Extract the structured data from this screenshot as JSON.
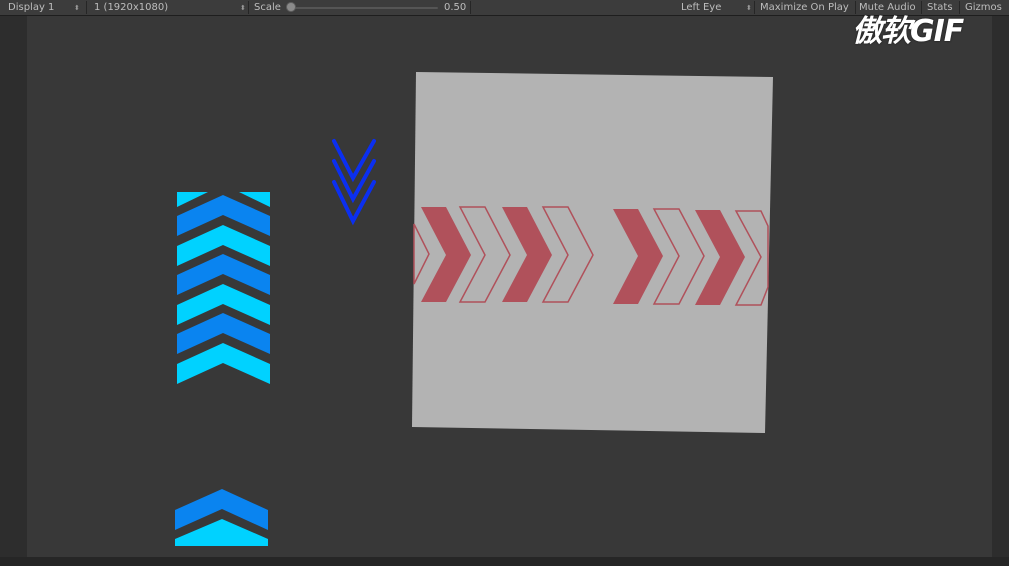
{
  "toolbar": {
    "display_label": "Display 1",
    "resolution_label": "1 (1920x1080)",
    "scale_label": "Scale",
    "scale_value": "0.50",
    "scale_fraction": 0.02,
    "eye_label": "Left Eye",
    "maximize_label": "Maximize On Play",
    "mute_label": "Mute Audio",
    "stats_label": "Stats",
    "gizmos_label": "Gizmos"
  },
  "watermark": {
    "text": "傲软GIF"
  },
  "colors": {
    "toolbar_bg": "#3c3c3c",
    "scene_bg": "#383838",
    "panel_gray": "#b3b3b3",
    "chevron_cyan": "#00d2ff",
    "chevron_blue": "#0a84f0",
    "chevron_dark_blue": "#0b2ff0",
    "arrow_red": "#b0515b"
  },
  "icons": {
    "dropdown": "chevron-updown-icon"
  }
}
